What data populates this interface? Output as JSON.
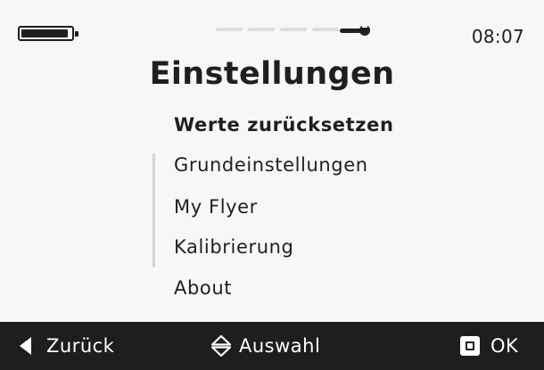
{
  "status_bar": {
    "battery_level": 0.95,
    "wizard_progress_steps": 4,
    "settings_icon": "wrench-icon",
    "time": "08:07"
  },
  "page": {
    "title": "Einstellungen"
  },
  "menu": {
    "selected_index": 0,
    "items": [
      {
        "label": "Werte zurücksetzen"
      },
      {
        "label": "Grundeinstellungen"
      },
      {
        "label": "My Flyer"
      },
      {
        "label": "Kalibrierung"
      },
      {
        "label": "About"
      }
    ]
  },
  "bottom_bar": {
    "back": {
      "label": "Zurück",
      "icon": "triangle-left-icon"
    },
    "select": {
      "label": "Auswahl",
      "icon": "up-down-arrows-icon"
    },
    "ok": {
      "label": "OK",
      "icon": "square-button-icon"
    }
  },
  "colors": {
    "background": "#f7f7f7",
    "text": "#1f1f1f",
    "bottom_bar": "#1e1e1e",
    "bottom_bar_text": "#ffffff",
    "progress_dash": "#dddddd"
  }
}
